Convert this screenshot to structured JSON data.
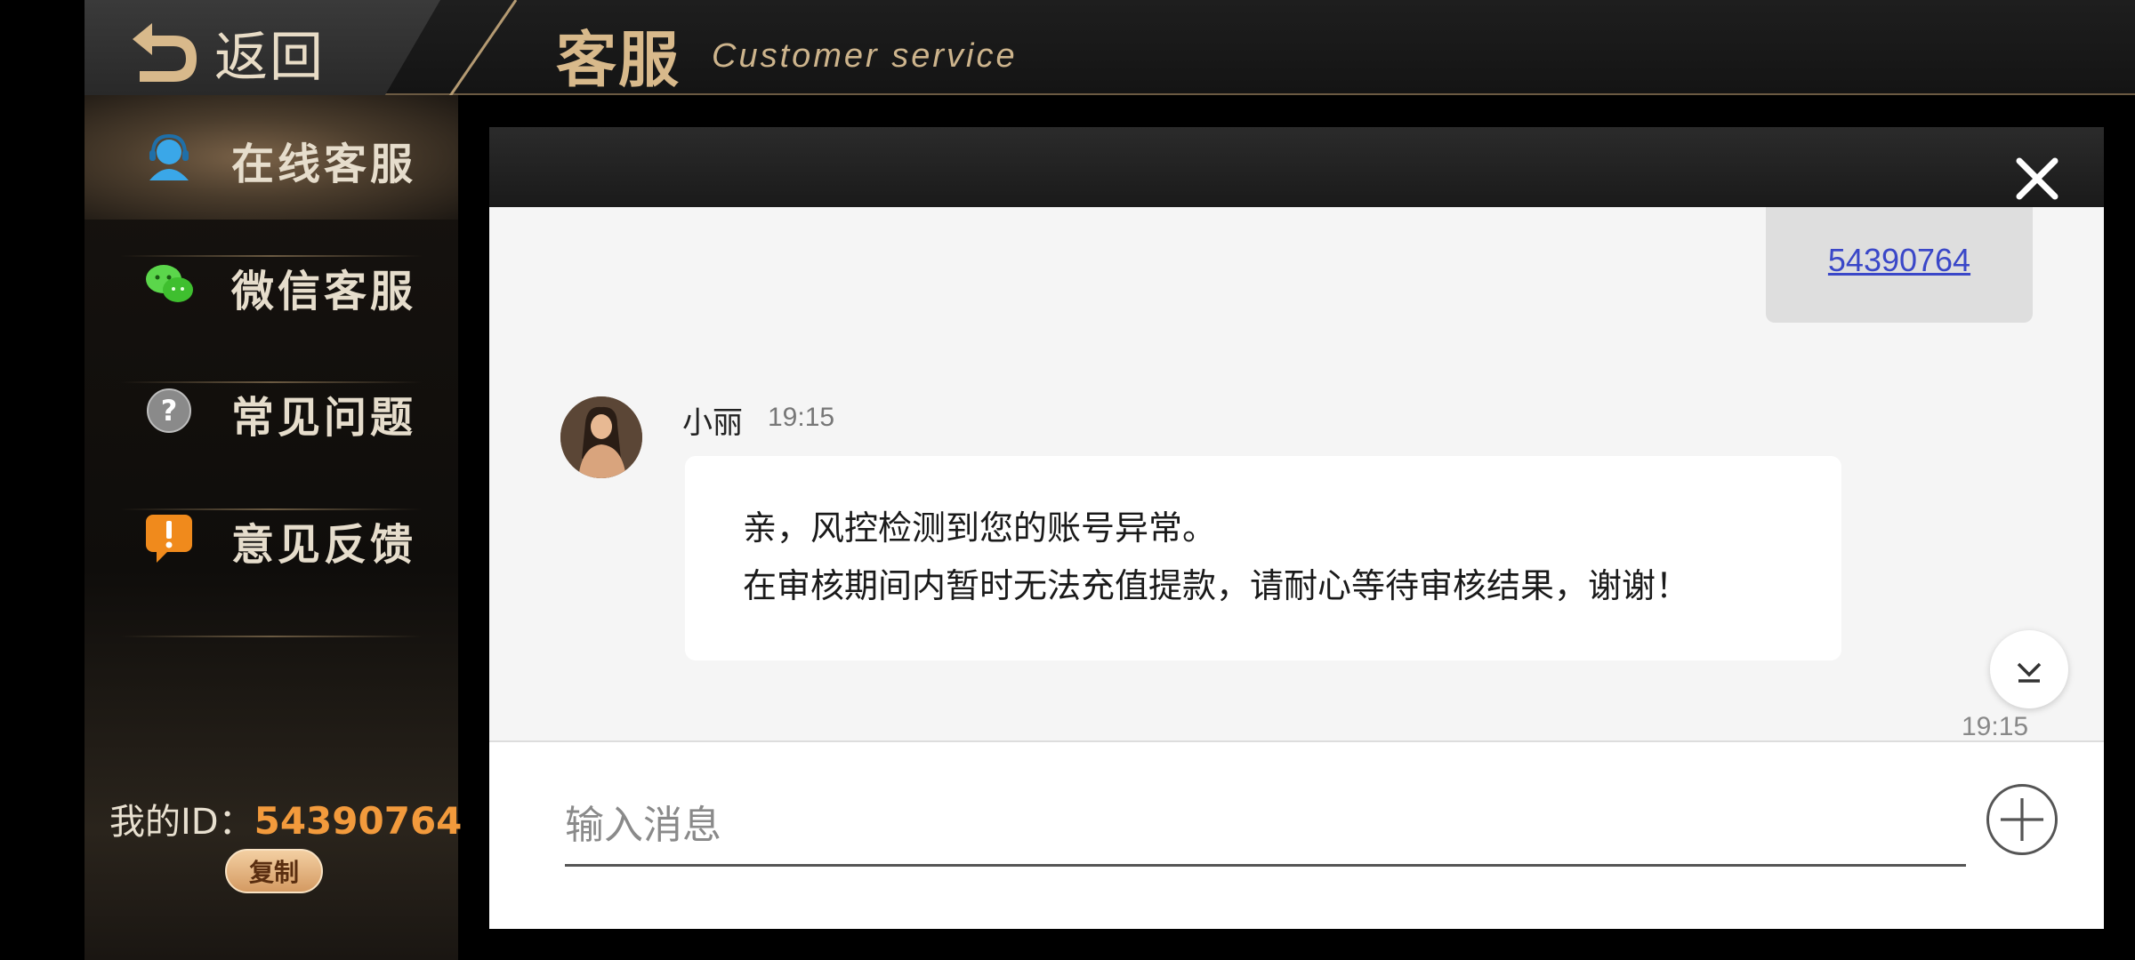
{
  "header": {
    "back_label": "返回",
    "title_cn": "客服",
    "title_en": "Customer service"
  },
  "sidebar": {
    "items": [
      {
        "label": "在线客服",
        "icon": "headset-user-icon",
        "active": true
      },
      {
        "label": "微信客服",
        "icon": "wechat-icon",
        "active": false
      },
      {
        "label": "常见问题",
        "icon": "question-icon",
        "active": false
      },
      {
        "label": "意见反馈",
        "icon": "exclamation-bubble-icon",
        "active": false
      }
    ],
    "my_id_label": "我的ID：",
    "my_id_value": "54390764",
    "copy_label": "复制"
  },
  "chat": {
    "sent_message": "54390764",
    "agent_name": "小丽",
    "agent_time": "19:15",
    "received_lines": [
      "亲，风控检测到您的账号异常。",
      "在审核期间内暂时无法充值提款，请耐心等待审核结果，谢谢！"
    ],
    "bottom_time": "19:15"
  },
  "input": {
    "placeholder": "输入消息",
    "value": ""
  },
  "colors": {
    "accent_gold": "#d8b98b",
    "id_orange": "#f29a3c",
    "link_blue": "#3a47c8"
  }
}
